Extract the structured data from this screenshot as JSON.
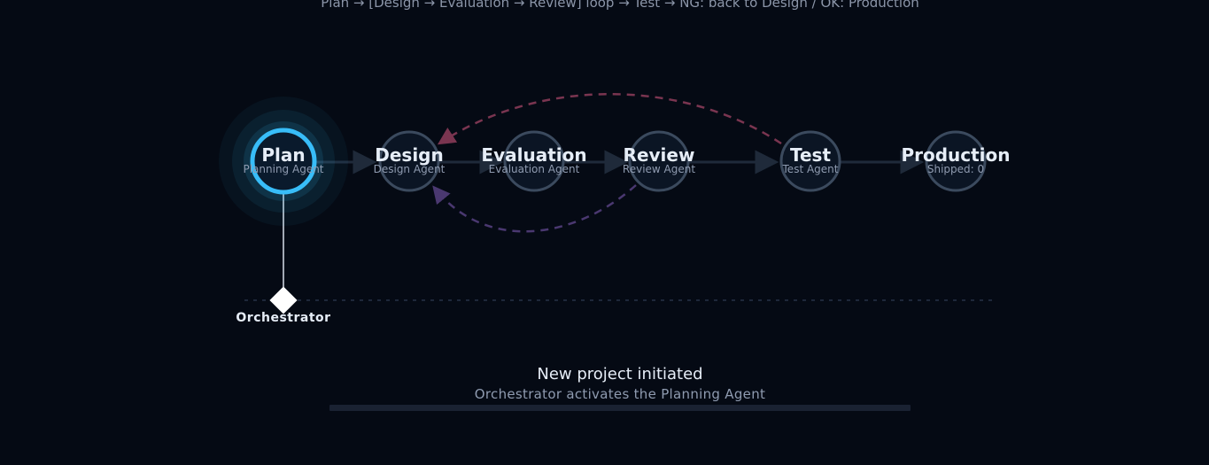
{
  "caption": "Plan → [Design → Evaluation → Review] loop → Test → NG: back to Design / OK: Production",
  "nodes": [
    {
      "id": "plan",
      "title": "Plan",
      "subtitle": "Planning Agent",
      "active": true
    },
    {
      "id": "design",
      "title": "Design",
      "subtitle": "Design Agent",
      "active": false
    },
    {
      "id": "evaluation",
      "title": "Evaluation",
      "subtitle": "Evaluation Agent",
      "active": false
    },
    {
      "id": "review",
      "title": "Review",
      "subtitle": "Review Agent",
      "active": false
    },
    {
      "id": "test",
      "title": "Test",
      "subtitle": "Test Agent",
      "active": false
    },
    {
      "id": "production",
      "title": "Production",
      "subtitle": "Shipped: 0",
      "active": false
    }
  ],
  "orchestrator": {
    "label": "Orchestrator"
  },
  "status": {
    "title": "New project initiated",
    "subtitle": "Orchestrator activates the Planning Agent",
    "progress": 0
  },
  "colors": {
    "background": "#050a14",
    "active": "#38bdf8",
    "node_stroke": "#3b4a5e",
    "ng_loop": "#7a3550",
    "review_loop": "#4a3870"
  }
}
